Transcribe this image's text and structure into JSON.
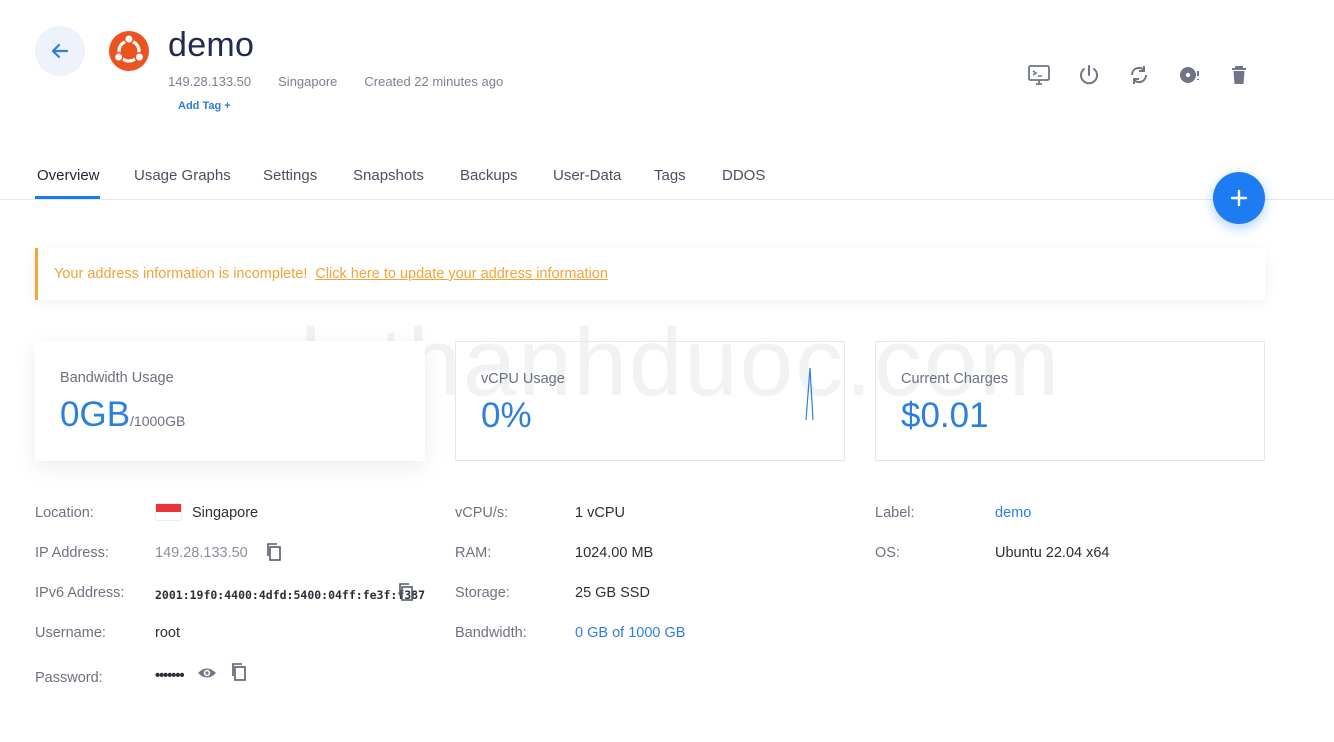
{
  "header": {
    "title": "demo",
    "ip": "149.28.133.50",
    "location": "Singapore",
    "created": "Created 22 minutes ago",
    "add_tag": "Add Tag +"
  },
  "icons": {
    "back": "arrow-left-icon",
    "os": "ubuntu-logo-icon",
    "actions": [
      "console-icon",
      "power-icon",
      "restart-icon",
      "iso-disc-icon",
      "trash-icon"
    ],
    "fab": "plus-icon"
  },
  "tabs": [
    {
      "label": "Overview",
      "active": true
    },
    {
      "label": "Usage Graphs"
    },
    {
      "label": "Settings"
    },
    {
      "label": "Snapshots"
    },
    {
      "label": "Backups"
    },
    {
      "label": "User-Data"
    },
    {
      "label": "Tags"
    },
    {
      "label": "DDOS"
    }
  ],
  "alert": {
    "message": "Your address information is incomplete!",
    "link": "Click here to update your address information"
  },
  "watermark": "duthanhduoc.com",
  "cards": {
    "bandwidth": {
      "label": "Bandwidth Usage",
      "value": "0GB",
      "unit": "/1000GB"
    },
    "vcpu": {
      "label": "vCPU Usage",
      "value": "0%"
    },
    "charges": {
      "label": "Current Charges",
      "value": "$0.01"
    }
  },
  "details": {
    "left": {
      "location_label": "Location:",
      "location_value": "Singapore",
      "ip_label": "IP Address:",
      "ip_value": "149.28.133.50",
      "ipv6_label": "IPv6 Address:",
      "ipv6_value": "2001:19f0:4400:4dfd:5400:04ff:fe3f:f387",
      "username_label": "Username:",
      "username_value": "root",
      "password_label": "Password:",
      "password_value": "•••••••"
    },
    "middle": {
      "vcpu_label": "vCPU/s:",
      "vcpu_value": "1 vCPU",
      "ram_label": "RAM:",
      "ram_value": "1024.00 MB",
      "storage_label": "Storage:",
      "storage_value": "25 GB SSD",
      "bandwidth_label": "Bandwidth:",
      "bandwidth_value": "0 GB of 1000 GB"
    },
    "right": {
      "label_label": "Label:",
      "label_value": "demo",
      "os_label": "OS:",
      "os_value": "Ubuntu 22.04 x64"
    }
  },
  "colors": {
    "accent": "#1d7cf2",
    "warning": "#f2a33a",
    "title": "#232a4d"
  }
}
